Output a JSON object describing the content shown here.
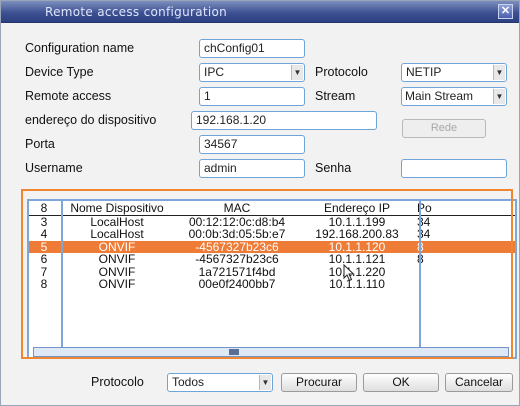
{
  "window": {
    "title": "Remote access configuration",
    "close_glyph": "✕"
  },
  "form": {
    "config_name": {
      "label": "Configuration name",
      "value": "chConfig01"
    },
    "device_type": {
      "label": "Device Type",
      "value": "IPC"
    },
    "protocol": {
      "label": "Protocolo",
      "value": "NETIP"
    },
    "remote_access": {
      "label": "Remote access",
      "value": "1"
    },
    "stream": {
      "label": "Stream",
      "value": "Main Stream"
    },
    "address": {
      "label": "endereço do dispositivo",
      "value": "192.168.1.20"
    },
    "rede_button": "Rede",
    "port": {
      "label": "Porta",
      "value": "34567"
    },
    "username": {
      "label": "Username",
      "value": "admin"
    },
    "password": {
      "label": "Senha",
      "value": ""
    }
  },
  "table": {
    "headers": [
      "8",
      "Nome Dispositivo",
      "MAC",
      "Endereço IP",
      "Po"
    ],
    "rows": [
      {
        "n": "3",
        "name": "LocalHost",
        "mac": "00:12:12:0c:d8:b4",
        "ip": "10.1.1.199",
        "port": "34"
      },
      {
        "n": "4",
        "name": "LocalHost",
        "mac": "00:0b:3d:05:5b:e7",
        "ip": "192.168.200.83",
        "port": "34"
      },
      {
        "n": "5",
        "name": "ONVIF",
        "mac": "-4567327b23c6",
        "ip": "10.1.1.120",
        "port": "8"
      },
      {
        "n": "6",
        "name": "ONVIF",
        "mac": "-4567327b23c6",
        "ip": "10.1.1.121",
        "port": "8"
      },
      {
        "n": "7",
        "name": "ONVIF",
        "mac": "1a721571f4bd",
        "ip": "10.1.1.220",
        "port": ""
      },
      {
        "n": "8",
        "name": "ONVIF",
        "mac": "00e0f2400bb7",
        "ip": "10.1.1.110",
        "port": ""
      }
    ],
    "selected_row": 2
  },
  "footer": {
    "protocol_label": "Protocolo",
    "protocol_value": "Todos",
    "search_button": "Procurar",
    "ok_button": "OK",
    "cancel_button": "Cancelar"
  },
  "colors": {
    "titlebar": "#3e5293",
    "selection": "#ee7b36",
    "field_border": "#6fa4da",
    "orange_frame": "#f0862f"
  }
}
